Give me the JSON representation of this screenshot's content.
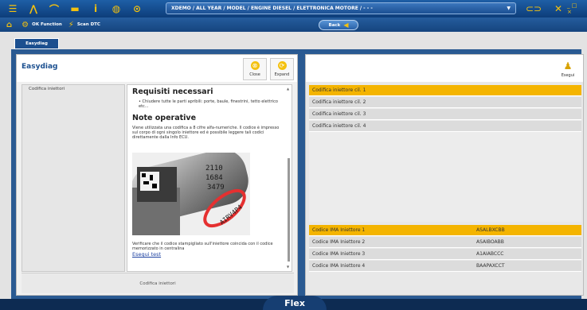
{
  "toolbar": {
    "breadcrumb": "XDEMO / ALL YEAR / MODEL / ENGINE DIESEL / ELETTRONICA MOTORE / - - -",
    "function_label": "OK Function",
    "scan_label": "Scan DTC",
    "back_label": "Back"
  },
  "tab": {
    "label": "Easydiag"
  },
  "left_panel": {
    "title": "Easydiag",
    "close_label": "Close",
    "expand_label": "Expand",
    "nav_item": "Codifica iniettori",
    "requisiti_title": "Requisiti necessari",
    "requisiti_text": "• Chiudere tutte le parti apribili: porte, baule, finestrini, tetto elettrico etc...",
    "note_title": "Note operative",
    "note_text": "Viene utilizzata una codifica a 8 cifre alfa-numeriche. Il codice è impresso sul corpo di ogni singolo iniettore ed è possibile leggere tali codici direttamente dalla Info ECU.",
    "verify_text": "Verificare che il codice stampigliato sull'iniettore coincida con il codice memorizzato in centralina",
    "link_label": "Esegui test",
    "footer_label": "Codifica iniettori",
    "image_text": [
      "2110",
      "1684",
      "3479",
      "AIRV4P4"
    ]
  },
  "right_panel": {
    "exec_label": "Esegui",
    "injectors": [
      "Codifica iniettore cil. 1",
      "Codifica iniettore cil. 2",
      "Codifica iniettore cil. 3",
      "Codifica iniettore cil. 4"
    ],
    "ima_rows": [
      {
        "label": "Codice IMA Iniettore 1",
        "value": "ASALBXCBB"
      },
      {
        "label": "Codice IMA Iniettore 2",
        "value": "ASAIBOABB"
      },
      {
        "label": "Codice IMA Iniettore 3",
        "value": "A1AIABCCC"
      },
      {
        "label": "Codice IMA Iniettore 4",
        "value": "BAAPAXCCT"
      }
    ]
  },
  "footer": {
    "brand": "Flex"
  },
  "colors": {
    "accent": "#f4b400",
    "navy": "#0e2f5a",
    "panel_blue": "#2a5a92"
  }
}
